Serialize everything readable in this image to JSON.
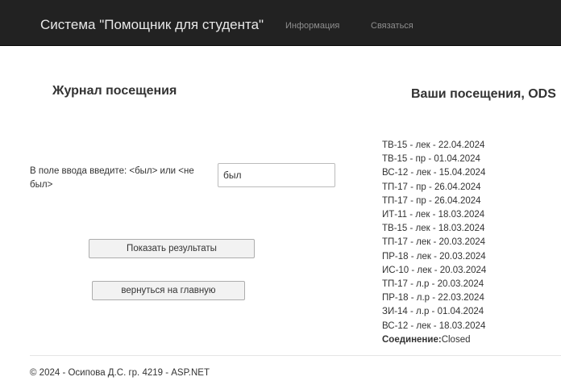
{
  "navbar": {
    "brand": "Система \"Помощник для студента\"",
    "links": [
      "Информация",
      "Связаться"
    ]
  },
  "left": {
    "title": "Журнал посещения",
    "input_label": "В поле ввода введите: <был> или <не был>",
    "input_value": "был",
    "show_button": "Показать результаты",
    "back_button": "вернуться на главную"
  },
  "right": {
    "title": "Ваши посещения, ODS",
    "visits": [
      "ТВ-15 - лек - 22.04.2024",
      "ТВ-15 - пр - 01.04.2024",
      "ВС-12 - лек - 15.04.2024",
      "ТП-17 - пр - 26.04.2024",
      "ТП-17 - пр - 26.04.2024",
      "ИТ-11 - лек - 18.03.2024",
      "ТВ-15 - лек - 18.03.2024",
      "ТП-17 - лек - 20.03.2024",
      "ПР-18 - лек - 20.03.2024",
      "ИС-10 - лек - 20.03.2024",
      "ТП-17 - л.р - 20.03.2024",
      "ПР-18 - л.р - 22.03.2024",
      "ЗИ-14 - л.р - 01.04.2024",
      "ВС-12 - лек - 18.03.2024"
    ],
    "connection_label": "Соединение:",
    "connection_value": "Closed"
  },
  "footer": {
    "text": "© 2024 - Осипова Д.С. гр. 4219 - ASP.NET"
  }
}
